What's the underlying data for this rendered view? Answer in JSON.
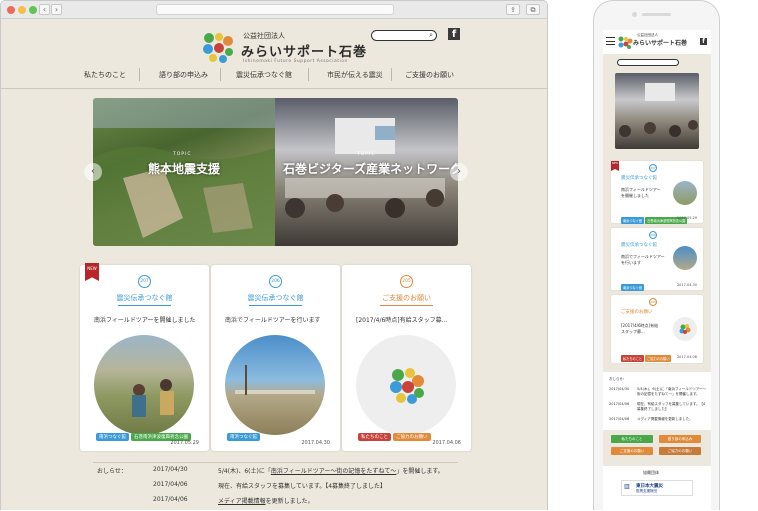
{
  "colors": {
    "green": "#4aa84a",
    "blue": "#3b9bd8",
    "orange": "#e08a3a",
    "red": "#c8443b",
    "navy": "#1c3b8c"
  },
  "browser": {
    "back_icon": "‹",
    "forward_icon": "›",
    "share_icon": "⇪",
    "tabs_icon": "⧉"
  },
  "site": {
    "logo_small": "公益社団法人",
    "logo_name": "みらいサポート石巻",
    "logo_en": "Ishinomaki Future Support Association",
    "search_icon": "⌕",
    "fb_icon": "f",
    "nav": [
      "私たちのこと",
      "語り部の申込み",
      "震災伝承つなぐ館",
      "市民が伝える震災",
      "ご支援のお願い"
    ],
    "slides": [
      {
        "topic": "TOPIC",
        "title": "熊本地震支援"
      },
      {
        "topic": "TOPIC",
        "title": "石巻ビジターズ産業ネットワーク"
      }
    ],
    "arrow_prev": "‹",
    "arrow_next": "›",
    "cards": [
      {
        "new": "NEW",
        "num": "207",
        "category": "震災伝承つなぐ館",
        "desc": "南浜フィールドツアーを開催しました",
        "tags": [
          "南浜つなぐ館",
          "石巻南浜津波復興祈念公園"
        ],
        "date": "2017.05.29",
        "color": "#3b9bd8"
      },
      {
        "num": "206",
        "category": "震災伝承つなぐ館",
        "desc": "南浜でフィールドツアーを行います",
        "tags": [
          "南浜つなぐ館"
        ],
        "date": "2017.04.30",
        "color": "#3b9bd8"
      },
      {
        "num": "205",
        "category": "ご支援のお願い",
        "desc": "[2017/4/6時点]有給スタッフ募...",
        "tags": [
          "私たちのこと",
          "ご協力のお願い"
        ],
        "date": "2017.04.06",
        "color": "#e08a3a"
      }
    ],
    "news_label": "おしらせ：",
    "news": [
      {
        "date": "2017/04/30",
        "text_pre": "5/4(木)、6(土)に「",
        "link": "南浜フィールドツアー〜街の記憶をたずねて〜",
        "text_post": "」を開催します。"
      },
      {
        "date": "2017/04/06",
        "text_pre": "現在、有給スタッフを募集しています。【4募集終了しました】",
        "link": "",
        "text_post": ""
      },
      {
        "date": "2017/04/06",
        "text_pre": "",
        "link": "メディア掲載情報",
        "text_post": "を更新しました。"
      }
    ]
  },
  "phone": {
    "logo_small": "公益社団法人",
    "logo_name": "みらいサポート石巻",
    "fb_icon": "f",
    "cards": [
      {
        "new": "NEW",
        "num": "207",
        "category": "震災伝承つなぐ館",
        "desc1": "南浜フィールドツアー",
        "desc2": "を開催しました",
        "tags": [
          "南浜つなぐ館",
          "石巻南浜津波復興祈念公園"
        ],
        "date": "2017.05.29"
      },
      {
        "num": "206",
        "category": "震災伝承つなぐ館",
        "desc1": "南浜でフィールドツアー",
        "desc2": "を行います",
        "tags": [
          "南浜つなぐ館"
        ],
        "date": "2017.04.30"
      },
      {
        "num": "205",
        "category": "ご支援のお願い",
        "desc1": "[2017/4/6時点]有給",
        "desc2": "スタッフ募...",
        "tags": [
          "私たちのこと",
          "ご協力のお願い"
        ],
        "date": "2017.04.06"
      }
    ],
    "news_label": "おしらせ：",
    "news": [
      {
        "date": "2017/04/30",
        "text": "5/4(木)、6(土)に「南浜フィールドツアー〜街の記憶をたずねて〜」を開催します。"
      },
      {
        "date": "2017/04/06",
        "text": "現在、有給スタッフを募集しています。【4募集終了しました】"
      },
      {
        "date": "2017/04/06",
        "text": "メディア掲載情報を更新しました。"
      }
    ],
    "buttons": [
      "私たちのこと",
      "語り部の申込み",
      "ご支援のお願い",
      "ご協力のお願い"
    ],
    "footer_label": "協賛団体",
    "footer_logo": "東日本大震災",
    "footer_logo2": "復興支援財団"
  }
}
